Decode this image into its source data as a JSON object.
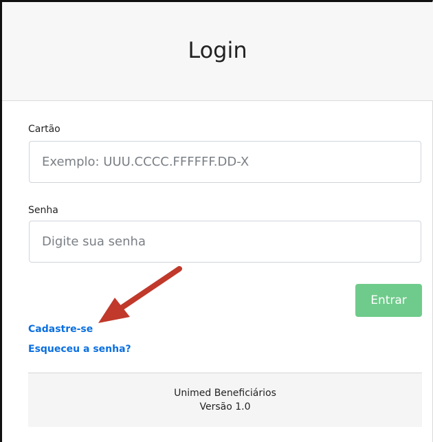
{
  "header": {
    "title": "Login"
  },
  "form": {
    "card_label": "Cartão",
    "card_placeholder": "Exemplo: UUU.CCCC.FFFFFF.DD-X",
    "card_value": "",
    "password_label": "Senha",
    "password_placeholder": "Digite sua senha",
    "password_value": "",
    "submit_label": "Entrar"
  },
  "links": {
    "register": "Cadastre-se",
    "forgot": "Esqueceu a senha?"
  },
  "footer": {
    "app_name": "Unimed Beneficiários",
    "version": "Versão 1.0"
  },
  "annotation": {
    "arrow_icon": "red-arrow-icon",
    "arrow_color": "#c0392b"
  },
  "colors": {
    "submit_button": "#6fcb8b",
    "link": "#0a6fe0"
  }
}
